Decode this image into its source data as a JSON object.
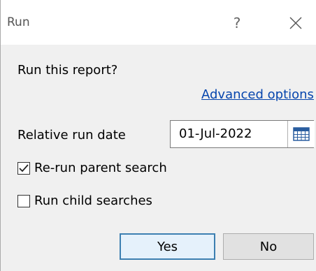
{
  "dialog": {
    "title": "Run",
    "help_glyph": "?",
    "prompt": "Run this report?",
    "advanced_link": "Advanced options",
    "date_label": "Relative run date",
    "date_value": "01-Jul-2022",
    "rerun_parent": {
      "label": "Re-run parent search",
      "checked": true
    },
    "run_children": {
      "label": "Run child searches",
      "checked": false
    },
    "yes_label": "Yes",
    "no_label": "No"
  },
  "icons": {
    "help": "question-mark",
    "close": "x-close",
    "calendar": "calendar-grid",
    "check": "check-mark"
  },
  "colors": {
    "link": "#0645ad",
    "default_button_border": "#3c7fb1",
    "calendar_icon": "#2a5d9f"
  }
}
